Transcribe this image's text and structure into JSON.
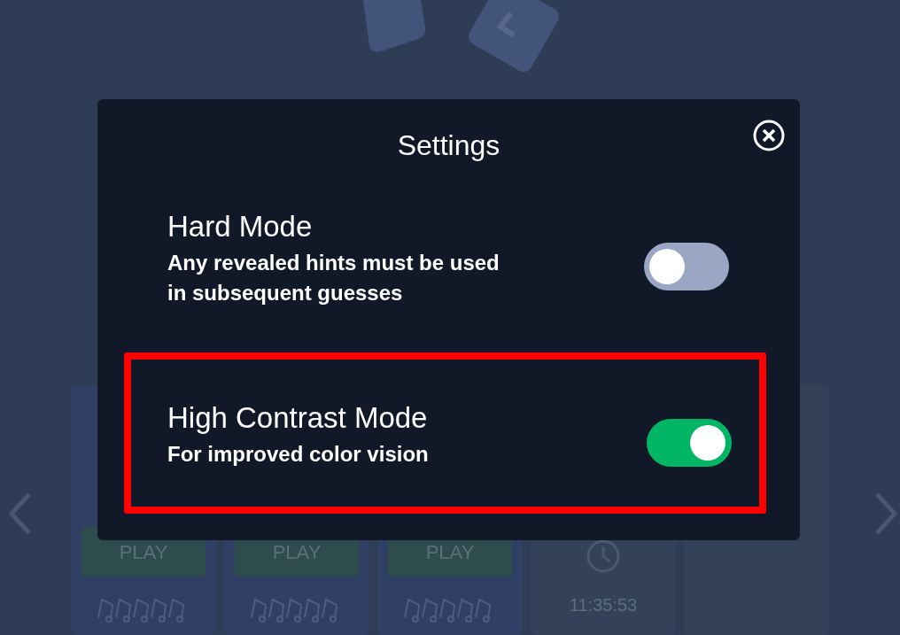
{
  "background": {
    "cards": [
      {
        "kind": "play",
        "button": "PLAY"
      },
      {
        "kind": "play",
        "button": "PLAY"
      },
      {
        "kind": "play",
        "button": "PLAY"
      },
      {
        "kind": "timer",
        "time": "11:35:53"
      },
      {
        "kind": "empty"
      }
    ]
  },
  "modal": {
    "title": "Settings",
    "settings": [
      {
        "title": "Hard Mode",
        "description": "Any revealed hints must be used in subsequent guesses",
        "on": false,
        "highlighted": false
      },
      {
        "title": "High Contrast Mode",
        "description": "For improved color vision",
        "on": true,
        "highlighted": true
      }
    ]
  }
}
